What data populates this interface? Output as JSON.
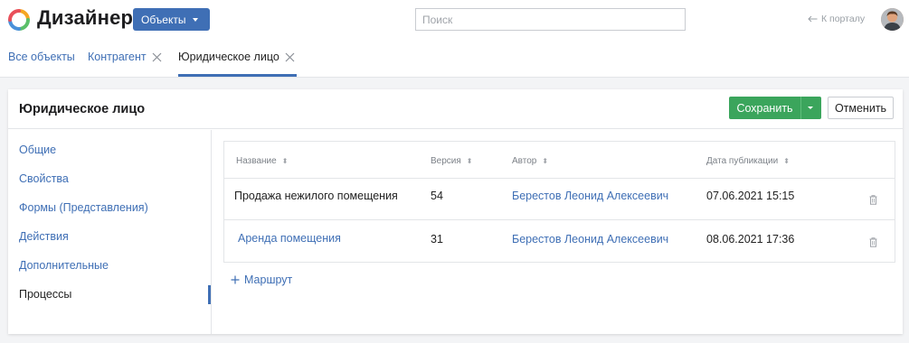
{
  "header": {
    "app_title": "Дизайнер",
    "objects_button": "Объекты",
    "search_placeholder": "Поиск",
    "portal_link": "К порталу"
  },
  "tabs": [
    {
      "label": "Все объекты",
      "closable": false,
      "active": false
    },
    {
      "label": "Контрагент",
      "closable": true,
      "active": false
    },
    {
      "label": "Юридическое лицо",
      "closable": true,
      "active": true
    }
  ],
  "panel": {
    "title": "Юридическое лицо",
    "save_label": "Сохранить",
    "cancel_label": "Отменить"
  },
  "sidebar": {
    "items": [
      {
        "label": "Общие",
        "active": false
      },
      {
        "label": "Свойства",
        "active": false
      },
      {
        "label": "Формы (Представления)",
        "active": false
      },
      {
        "label": "Действия",
        "active": false
      },
      {
        "label": "Дополнительные",
        "active": false
      },
      {
        "label": "Процессы",
        "active": true
      }
    ]
  },
  "table": {
    "columns": [
      "Название",
      "Версия",
      "Автор",
      "Дата публикации"
    ],
    "rows": [
      {
        "name": "Продажа нежилого помещения",
        "version": "54",
        "author": "Берестов Леонид Алексеевич",
        "date": "07.06.2021 15:15",
        "name_is_link": false
      },
      {
        "name": "Аренда помещения",
        "version": "31",
        "author": "Берестов Леонид Алексеевич",
        "date": "08.06.2021 17:36",
        "name_is_link": true
      }
    ]
  },
  "add_route_label": "Маршрут",
  "colors": {
    "accent": "#3f6fb5",
    "save_green": "#3ba55c",
    "background": "#f3f4f6"
  }
}
